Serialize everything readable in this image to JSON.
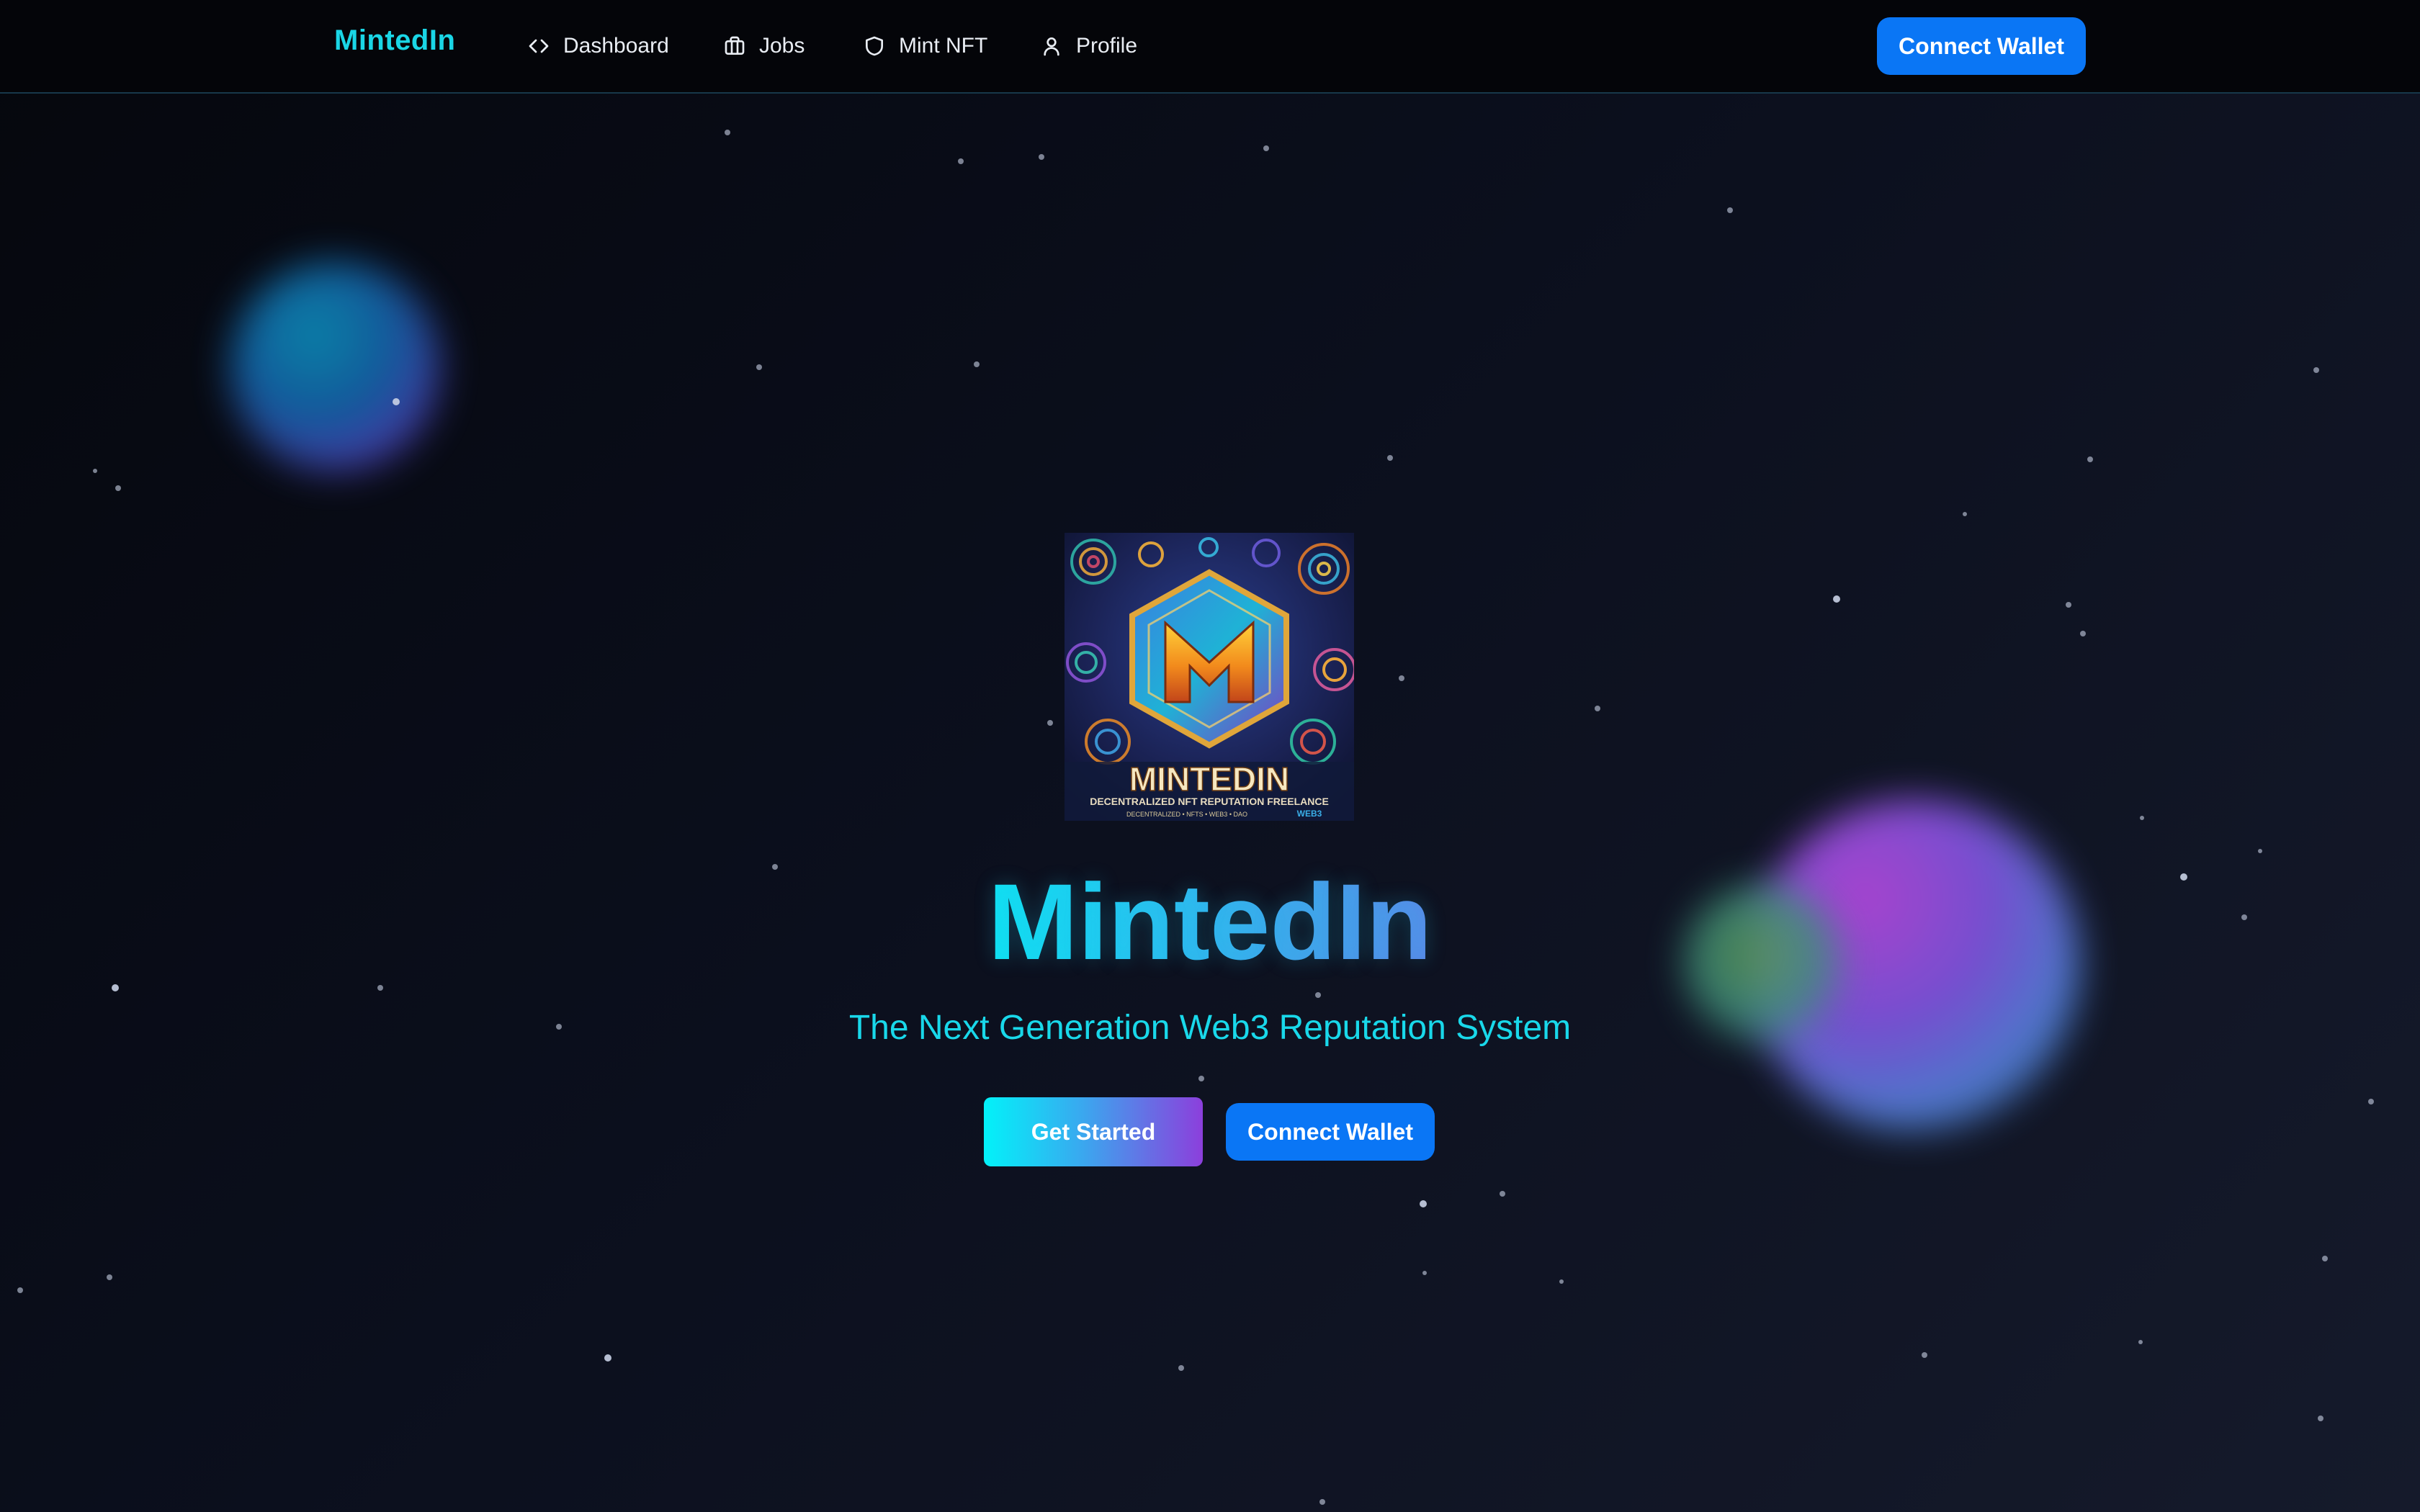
{
  "navbar": {
    "brand": "MintedIn",
    "items": [
      {
        "label": "Dashboard",
        "icon": "code-icon"
      },
      {
        "label": "Jobs",
        "icon": "briefcase-icon"
      },
      {
        "label": "Mint NFT",
        "icon": "shield-icon"
      },
      {
        "label": "Profile",
        "icon": "user-icon"
      }
    ],
    "connect_wallet_label": "Connect Wallet"
  },
  "hero": {
    "logo_text": "MINTEDIN",
    "logo_tagline": "DECENTRALIZED NFT REPUTATION FREELANCE",
    "logo_subtagline": "DECENTRALIZED • NFTS • WEB3 • DAO",
    "logo_badge": "WEB3",
    "title": "MintedIn",
    "subtitle": "The Next Generation Web3 Reputation System",
    "get_started_label": "Get Started",
    "connect_wallet_label": "Connect Wallet"
  },
  "colors": {
    "brand": "#1ad6e6",
    "accent_button": "#0a76f5",
    "background": "#0b0e18",
    "gradient_start": "#02f2f9",
    "gradient_end": "#8c3fdc"
  }
}
